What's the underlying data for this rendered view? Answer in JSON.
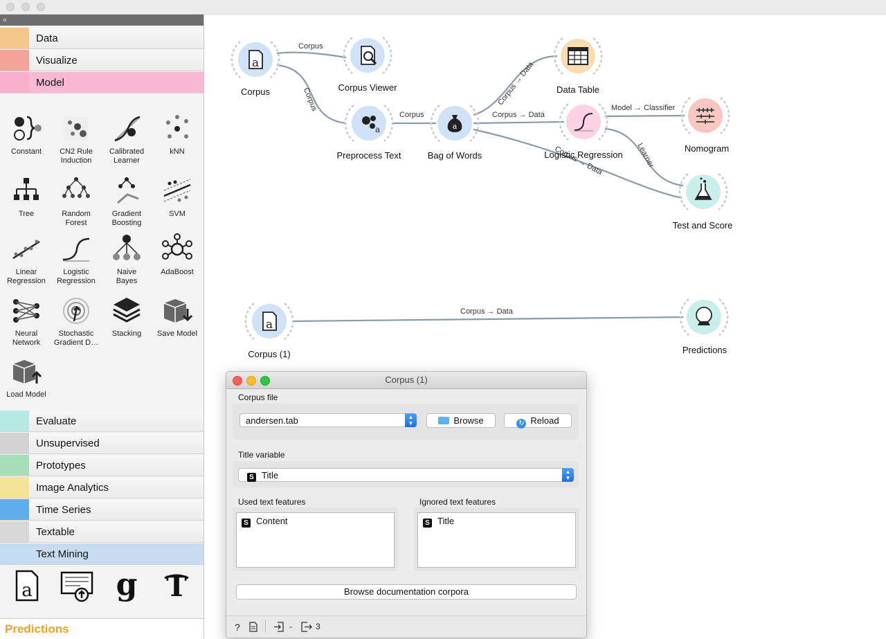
{
  "toolbox": {
    "categories": [
      {
        "label": "Data",
        "color": "#f3c789"
      },
      {
        "label": "Visualize",
        "color": "#f4a39a"
      },
      {
        "label": "Model",
        "color": "#f7aecb"
      },
      {
        "label": "Evaluate",
        "color": "#b6e8e4"
      },
      {
        "label": "Unsupervised",
        "color": "#d3d3d3"
      },
      {
        "label": "Prototypes",
        "color": "#a5dfb8"
      },
      {
        "label": "Image Analytics",
        "color": "#f6e39a"
      },
      {
        "label": "Time Series",
        "color": "#5faeea"
      },
      {
        "label": "Textable",
        "color": "#d8d8d8"
      },
      {
        "label": "Text Mining",
        "color": "#c6dcf2"
      }
    ],
    "model_widgets": [
      {
        "label": "Constant",
        "icon": "constant-icon"
      },
      {
        "label": "CN2 Rule\nInduction",
        "icon": "cn2-icon"
      },
      {
        "label": "Calibrated\nLearner",
        "icon": "calibrated-icon"
      },
      {
        "label": "kNN",
        "icon": "knn-icon"
      },
      {
        "label": "Tree",
        "icon": "tree-icon"
      },
      {
        "label": "Random\nForest",
        "icon": "random-forest-icon"
      },
      {
        "label": "Gradient\nBoosting",
        "icon": "gradient-boosting-icon"
      },
      {
        "label": "SVM",
        "icon": "svm-icon"
      },
      {
        "label": "Linear\nRegression",
        "icon": "linear-regression-icon"
      },
      {
        "label": "Logistic\nRegression",
        "icon": "logistic-regression-icon"
      },
      {
        "label": "Naive\nBayes",
        "icon": "naive-bayes-icon"
      },
      {
        "label": "AdaBoost",
        "icon": "adaboost-icon"
      },
      {
        "label": "Neural\nNetwork",
        "icon": "neural-network-icon"
      },
      {
        "label": "Stochastic\nGradient D…",
        "icon": "sgd-icon"
      },
      {
        "label": "Stacking",
        "icon": "stacking-icon"
      },
      {
        "label": "Save Model",
        "icon": "save-model-icon"
      },
      {
        "label": "Load Model",
        "icon": "load-model-icon"
      }
    ],
    "text_mining_icons": [
      "corpus-icon",
      "import-documents-icon",
      "guardian-icon",
      "nyt-icon"
    ],
    "help_title": "Predictions",
    "collapse_glyph": "«"
  },
  "canvas": {
    "nodes": [
      {
        "id": "corpus",
        "label": "Corpus",
        "color": "#cfe2f8",
        "icon": "corpus-icon"
      },
      {
        "id": "corpus_viewer",
        "label": "Corpus Viewer",
        "color": "#cfe2f8",
        "icon": "corpus-viewer-icon"
      },
      {
        "id": "preprocess",
        "label": "Preprocess Text",
        "color": "#cfe2f8",
        "icon": "preprocess-icon"
      },
      {
        "id": "bow",
        "label": "Bag of Words",
        "color": "#cfe2f8",
        "icon": "bag-of-words-icon"
      },
      {
        "id": "data_table",
        "label": "Data Table",
        "color": "#f9dcb0",
        "icon": "data-table-icon"
      },
      {
        "id": "logreg",
        "label": "Logistic Regression",
        "color": "#fbd3e3",
        "icon": "logistic-regression-icon"
      },
      {
        "id": "nomogram",
        "label": "Nomogram",
        "color": "#f8c7c1",
        "icon": "nomogram-icon"
      },
      {
        "id": "test_score",
        "label": "Test and Score",
        "color": "#c9efec",
        "icon": "test-score-icon"
      },
      {
        "id": "corpus1",
        "label": "Corpus (1)",
        "color": "#cfe2f8",
        "icon": "corpus-icon"
      },
      {
        "id": "predictions",
        "label": "Predictions",
        "color": "#c9efec",
        "icon": "predictions-icon"
      }
    ],
    "edge_labels": [
      "Corpus",
      "Corpus",
      "Corpus",
      "Corpus → Data",
      "Corpus → Data",
      "Model → Classifier",
      "Learner",
      "Corpus → Data",
      "Corpus → Data"
    ]
  },
  "dialog": {
    "title": "Corpus (1)",
    "corpus_file_label": "Corpus file",
    "file_value": "andersen.tab",
    "browse_label": "Browse",
    "reload_label": "Reload",
    "title_variable_label": "Title variable",
    "title_variable_value": "Title",
    "used_label": "Used text features",
    "used_items": [
      "Content"
    ],
    "ignored_label": "Ignored text features",
    "ignored_items": [
      "Title"
    ],
    "browse_docs_label": "Browse documentation corpora",
    "string_badge": "S",
    "status_input": "-",
    "status_output": "3"
  }
}
